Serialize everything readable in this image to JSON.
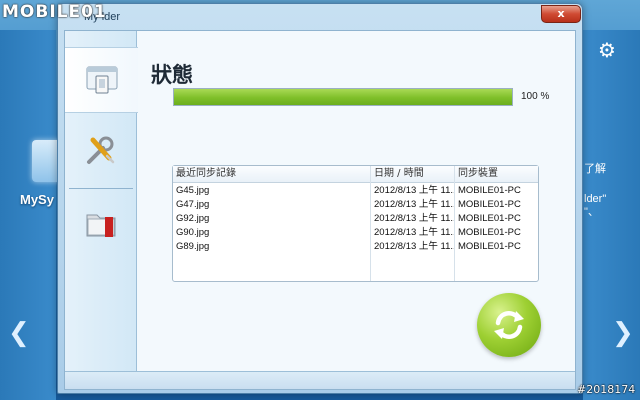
{
  "background": {
    "logo_text": "MOBILE01",
    "folder_label": "MySy",
    "right_lines": [
      "了解",
      "lder\"",
      "\"、"
    ],
    "watermark_id": "#2018174"
  },
  "window": {
    "title": "My  lder",
    "close_label": "x"
  },
  "sidebar": {
    "items": [
      {
        "name": "status",
        "icon": "sync-folder-icon",
        "active": true
      },
      {
        "name": "tools",
        "icon": "wrench-screwdriver-icon",
        "active": false
      },
      {
        "name": "folders",
        "icon": "red-folder-icon",
        "active": false
      }
    ]
  },
  "status": {
    "heading": "狀態",
    "progress": 100,
    "progress_label": "100 %"
  },
  "history": {
    "columns": [
      "最近同步記錄",
      "日期 / 時間",
      "同步裝置"
    ],
    "rows": [
      [
        "G45.jpg",
        "2012/8/13 上午 11...",
        "MOBILE01-PC"
      ],
      [
        "G47.jpg",
        "2012/8/13 上午 11...",
        "MOBILE01-PC"
      ],
      [
        "G92.jpg",
        "2012/8/13 上午 11...",
        "MOBILE01-PC"
      ],
      [
        "G90.jpg",
        "2012/8/13 上午 11...",
        "MOBILE01-PC"
      ],
      [
        "G89.jpg",
        "2012/8/13 上午 11...",
        "MOBILE01-PC"
      ]
    ]
  },
  "colors": {
    "progress": "#7fbf2a",
    "sync_button": "#9ed033",
    "close_button": "#cf4b33"
  }
}
